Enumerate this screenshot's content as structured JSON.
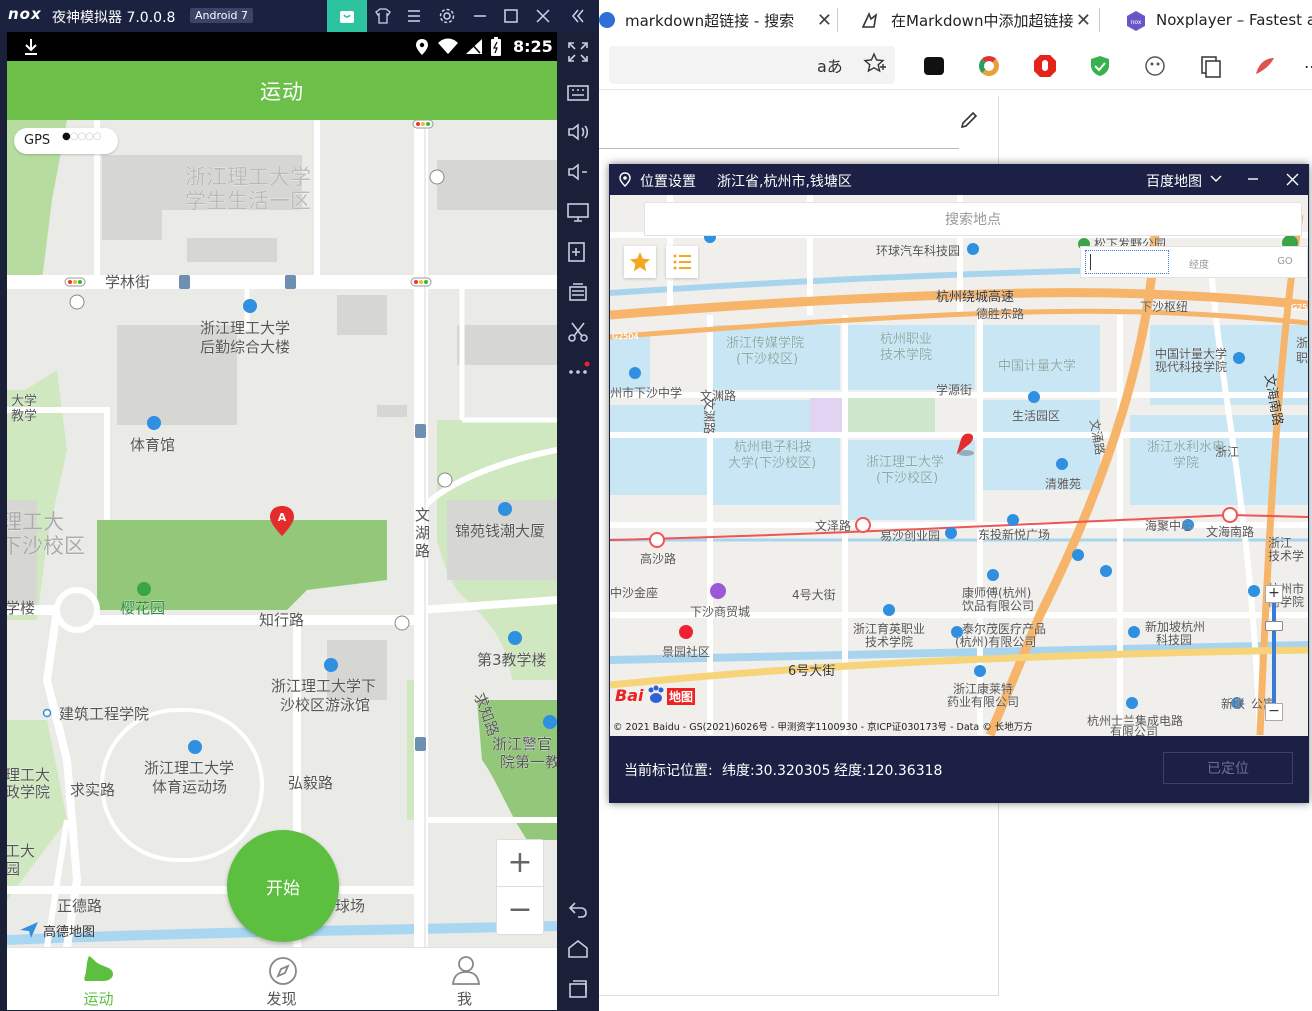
{
  "browser": {
    "tabs": [
      {
        "title": "markdown超链接 - 搜索"
      },
      {
        "title": "在Markdown中添加超链接"
      },
      {
        "title": "Noxplayer – Fastest and"
      }
    ],
    "read_aloud": "aあ"
  },
  "nox": {
    "brand": "nox",
    "title": "夜神模拟器 7.0.0.8",
    "android_badge": "Android 7"
  },
  "phone": {
    "time": "8:25",
    "app_title": "运动",
    "gps_label": "GPS",
    "start_button": "开始",
    "zoom_in": "+",
    "zoom_out": "−",
    "map_logo": "高德地图",
    "nav": [
      {
        "label": "运动",
        "active": true
      },
      {
        "label": "发现",
        "active": false
      },
      {
        "label": "我",
        "active": false
      }
    ],
    "map_labels": {
      "l1": "浙江理工大学",
      "l2": "学生生活一区",
      "l3": "学林街",
      "l4": "浙江理工大学",
      "l5": "后勤综合大楼",
      "l6": "体育馆",
      "l7": "理工大",
      "l8": "下沙校区",
      "l9": "大学",
      "l10": "教学",
      "l11": "锦苑钱潮大厦",
      "l12": "文",
      "l13": "湖",
      "l14": "路",
      "l15": "樱花园",
      "l16": "知行路",
      "l17": "学楼",
      "l18": "第3教学楼",
      "l19": "浙江理工大学下",
      "l20": "沙校区游泳馆",
      "l21": "建筑工程学院",
      "l22": "求知路",
      "l23": "浙江理工大学",
      "l24": "体育运动场",
      "l25": "弘毅路",
      "l26": "浙江警官",
      "l27": "院第一教",
      "l28": "理工大",
      "l29": "政学院",
      "l30": "求实路",
      "l31": "工大",
      "l32": "园",
      "l33": "正德路",
      "l34": "球场",
      "marker": "A"
    }
  },
  "dialog": {
    "title": "位置设置",
    "region": "浙江省,杭州市,钱塘区",
    "map_provider": "百度地图",
    "search_placeholder": "搜索地点",
    "lat_placeholder": "",
    "lng_placeholder": "经度",
    "go_label": "GO",
    "copyright": "© 2021 Baidu - GS(2021)6026号 - 甲测资字1100930 - 京ICP证030173号 - Data © 长地万方",
    "baidu_logo": "Bai",
    "baidu_logo2": "地图",
    "current_label": "当前标记位置:",
    "latitude_text": "纬度:30.320305",
    "longitude_text": "经度:120.36318",
    "located_button": "已定位",
    "map_labels": {
      "b1": "环球汽车科技园",
      "b2": "杭州绕城高速",
      "b3": "德胜东路",
      "b4": "松下发野公园",
      "b5": "下沙枢纽",
      "b6": "浙江传媒学院",
      "b7": "(下沙校区)",
      "b8": "杭州职业",
      "b9": "技术学院",
      "b10": "中国计量大学",
      "b11": "中国计量大学",
      "b12": "现代科技学院",
      "b13": "州市下沙中学",
      "b14": "学源街",
      "b15": "生活园区",
      "b16": "文渊路",
      "b17": "杭州电子科技",
      "b18": "大学(下沙校区)",
      "b19": "浙江理工大学",
      "b20": "(下沙校区)",
      "b21": "浙江水利水电",
      "b22": "学院",
      "b23": "清雅苑",
      "b24": "文海南路",
      "b25": "文泽路",
      "b26": "高沙路",
      "b27": "易沙创业园",
      "b28": "东投新悦广场",
      "b29": "海聚中心",
      "b30": "文海南路",
      "b31": "中沙金座",
      "b32": "下沙商贸城",
      "b33": "4号大街",
      "b34": "康师傅(杭州)",
      "b35": "饮品有限公司",
      "b36": "浙江育英职业",
      "b37": "技术学院",
      "b38": "泰尔茂医疗产品",
      "b39": "(杭州)有限公司",
      "b40": "新加坡杭州",
      "b41": "科技园",
      "b42": "景园社区",
      "b43": "6号大街",
      "b44": "浙江康莱特",
      "b45": "药业有限公司",
      "b46": "杭州士兰集成电路",
      "b47": "有限公司",
      "b48": "文海路",
      "b49": "浙江",
      "b50": "技术学",
      "b51": "杭州市",
      "b52": "商学院",
      "b53": "新联",
      "b54": "公寓",
      "b55": "浙",
      "b56": "职",
      "b57": "文涌路",
      "b58": "G25",
      "b59": "G2504",
      "b60": "文泽路"
    }
  }
}
